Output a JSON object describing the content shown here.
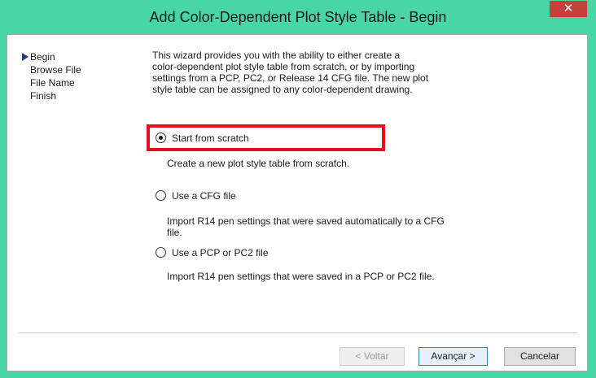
{
  "window": {
    "title": "Add Color-Dependent Plot Style Table - Begin",
    "close_glyph": "✕"
  },
  "nav": {
    "items": [
      {
        "label": "Begin",
        "current": true
      },
      {
        "label": "Browse File",
        "current": false
      },
      {
        "label": "File Name",
        "current": false
      },
      {
        "label": "Finish",
        "current": false
      }
    ]
  },
  "intro": {
    "lines": [
      "This wizard provides you with the ability to either create a",
      "color-dependent plot style table from scratch, or by importing",
      "settings from a PCP, PC2, or Release 14 CFG file. The new plot",
      "style table can be assigned to any color-dependent drawing."
    ]
  },
  "options": [
    {
      "label": "Start from scratch",
      "selected": true,
      "description": [
        "Create a new plot style table from scratch."
      ]
    },
    {
      "label": "Use a CFG file",
      "selected": false,
      "description": [
        "Import R14 pen settings that were saved automatically to a CFG",
        "file."
      ]
    },
    {
      "label": "Use a PCP or PC2 file",
      "selected": false,
      "description": [
        "Import R14 pen settings that were saved in a PCP or PC2 file."
      ]
    }
  ],
  "buttons": {
    "back": "< Voltar",
    "next": "Avançar >",
    "cancel": "Cancelar"
  },
  "colors": {
    "frame": "#48d6a6",
    "close": "#c7413a",
    "highlight": "#e8101e"
  }
}
